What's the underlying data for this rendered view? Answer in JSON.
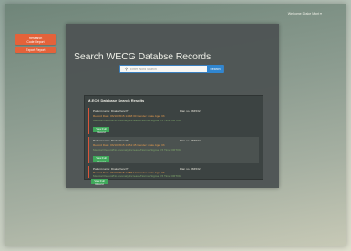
{
  "header": {
    "user_label": "Welcome Drake Mont ▾"
  },
  "sidebar": {
    "research_label": "Research\nCode Report",
    "export_label": "Export Report"
  },
  "main": {
    "title": "Search WECG Databse Records",
    "search": {
      "placeholder": "Enter Word Search",
      "button_label": "Search"
    }
  },
  "results": {
    "header": "M-ECG Database Search Results",
    "items": [
      {
        "patient": "Patient name: Drake Venci?",
        "report": "Plan no. 084532",
        "record": "Record Date: 03/10/2015 14:48:30   Gender: male   Age: 33",
        "summary": "Medical Record/No anomaly/Increase/Normal Sigma 0.5 Time ORTOM",
        "button_label": "View Full Record"
      },
      {
        "patient": "Patient name: Drake Venci?",
        "report": "Plan no. 084532",
        "record": "Record Date: 03/10/2015 14:51:45   Gender: male   Age: 33",
        "summary": "Medical Record/No anomaly/Increase/Normal Sigma 0.5 Time ORTOM",
        "button_label": "View Full Record"
      },
      {
        "patient": "Patient name: Drake Venci?",
        "report": "Plan no. 084532",
        "record": "Record Date: 03/10/2015 14:55:12   Gender: male   Age: 33",
        "summary": "Medical Record/No anomaly/Increase/Normal Sigma 0.5 Time ORTOM",
        "button_label": "View Full Record"
      }
    ]
  }
}
